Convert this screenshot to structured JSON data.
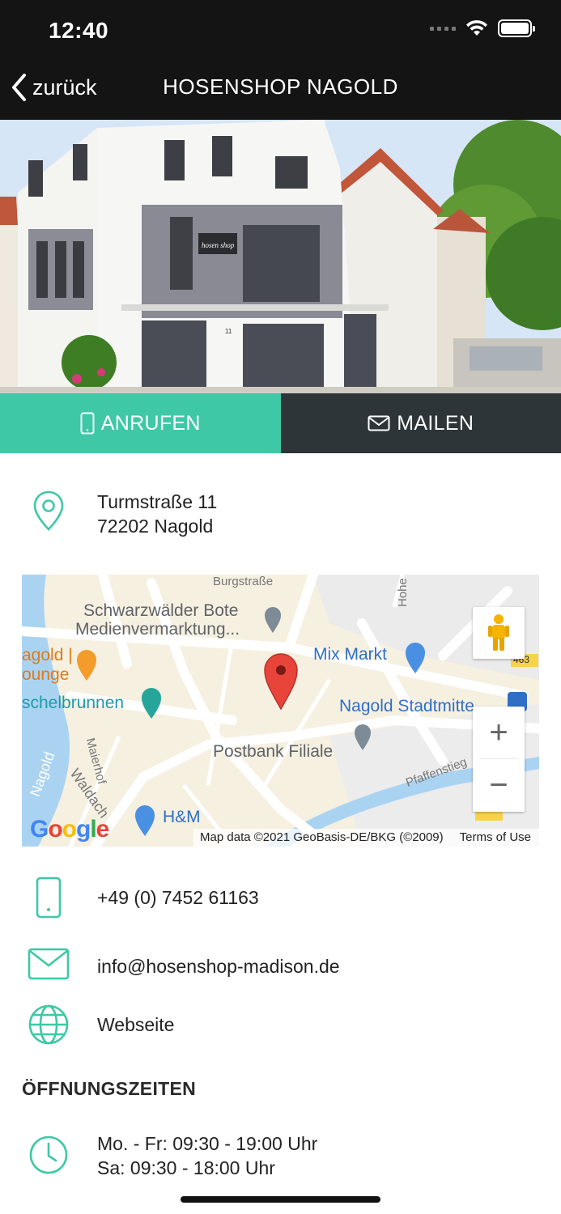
{
  "status_bar": {
    "time": "12:40"
  },
  "nav": {
    "back_label": "zurück",
    "title": "HOSENSHOP NAGOLD"
  },
  "hero": {
    "sign_text": "hosen shop",
    "house_number": "11"
  },
  "actions": {
    "call_label": "ANRUFEN",
    "mail_label": "MAILEN"
  },
  "address": {
    "street": "Turmstraße 11",
    "city": "72202 Nagold"
  },
  "map": {
    "labels": {
      "burgstrasse": "Burgstraße",
      "bote_1": "Schwarzwälder Bote",
      "bote_2": "Medienvermarktung...",
      "mix_markt": "Mix Markt",
      "nagold_1": "agold |",
      "nagold_2": "ounge",
      "brunnen": "schelbrunnen",
      "stadtmitte": "Nagold Stadtmitte",
      "postbank": "Postbank Filiale",
      "maierhof": "Maierhof",
      "waldach": "Waldach",
      "nagold_river": "Nagold",
      "hm": "H&M",
      "pfaffensteig": "Pfaffenstieg",
      "hohe": "Hohe S",
      "road_463": "463"
    },
    "attribution": "Map data ©2021 GeoBasis-DE/BKG (©2009)",
    "terms": "Terms of Use",
    "google": "Google",
    "zoom_in": "+",
    "zoom_out": "−"
  },
  "contact": {
    "phone": "+49 (0) 7452 61163",
    "email": "info@hosenshop-madison.de",
    "website": "Webseite"
  },
  "opening": {
    "title": "ÖFFNUNGSZEITEN",
    "weekdays": "Mo. - Fr: 09:30 - 19:00 Uhr",
    "saturday": "Sa: 09:30 - 18:00 Uhr"
  },
  "colors": {
    "accent": "#3ec8a6",
    "dark": "#2e3538",
    "link": "#3a6fb3"
  }
}
